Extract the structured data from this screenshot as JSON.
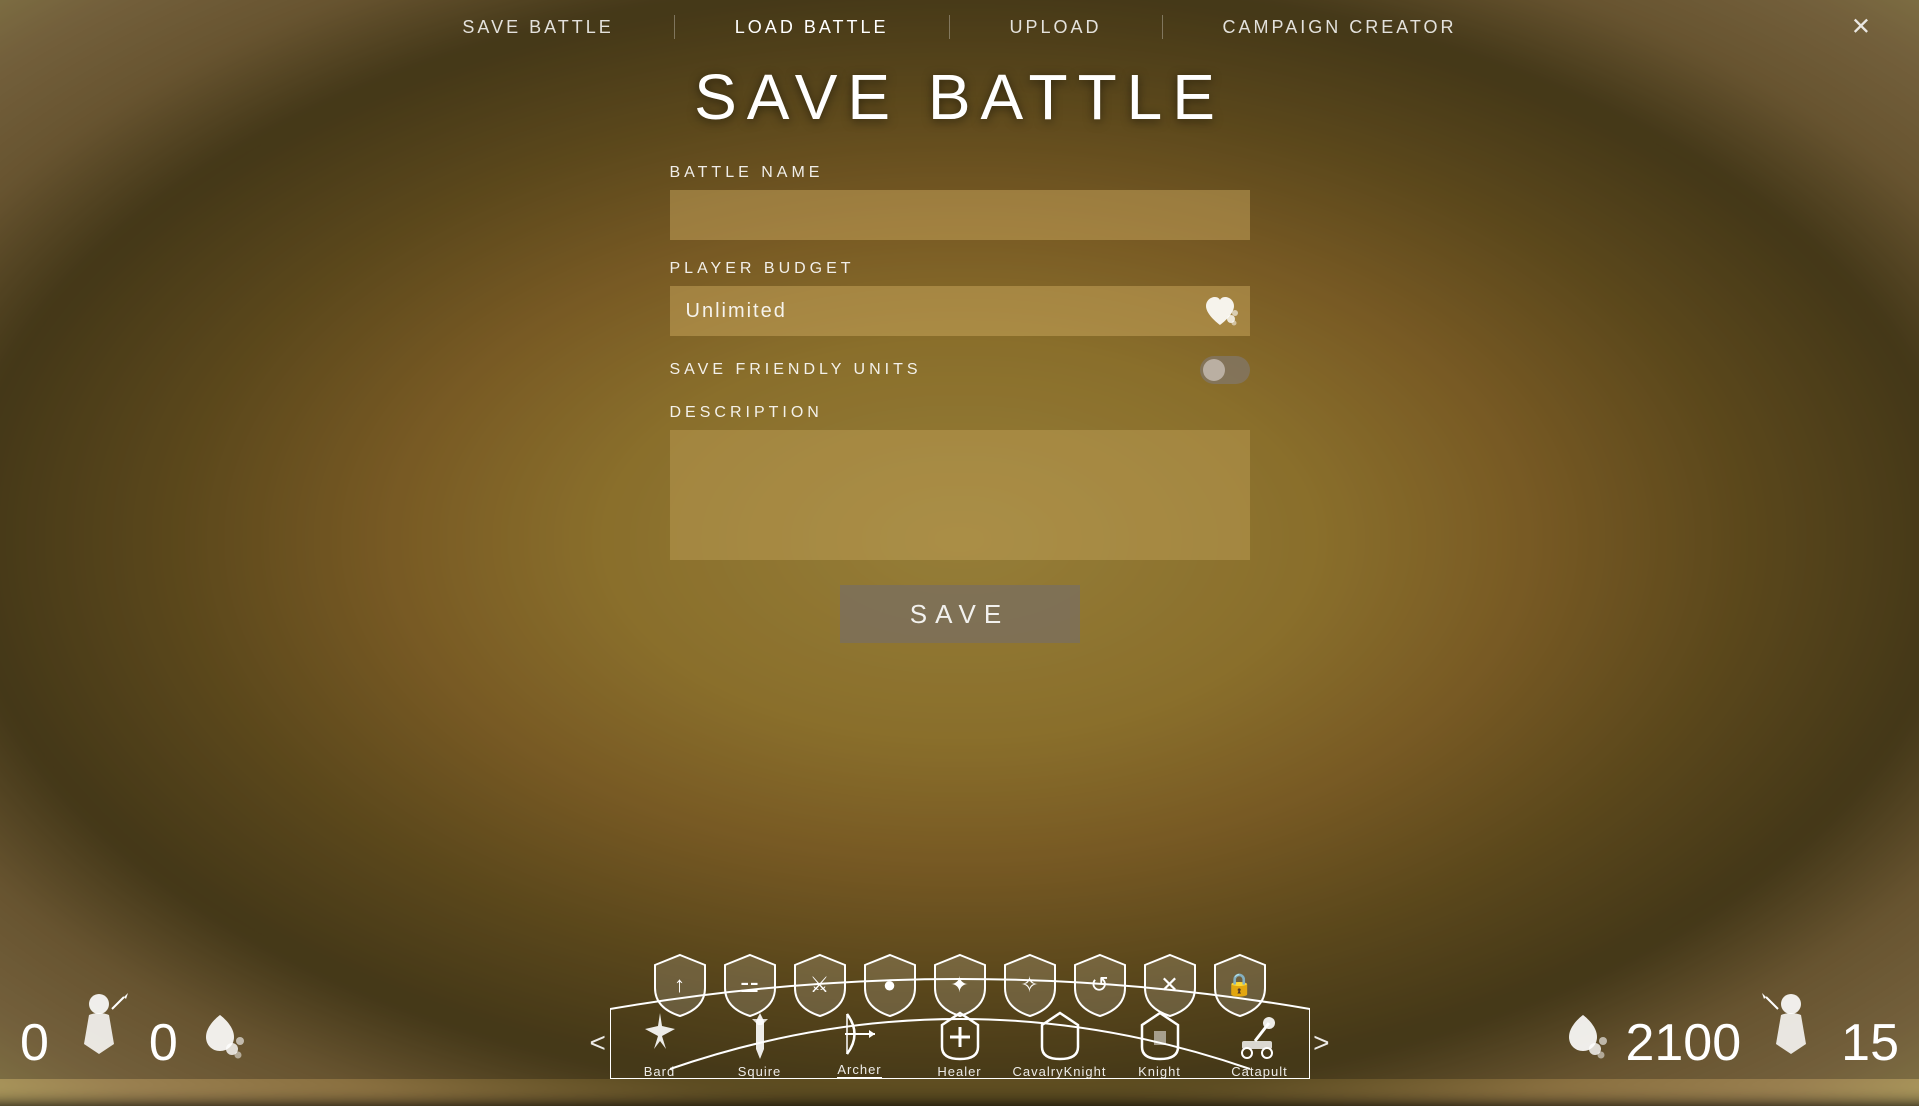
{
  "nav": {
    "save_battle": "Save Battle",
    "load_battle": "Load Battle",
    "upload": "Upload",
    "campaign_creator": "Campaign Creator",
    "close": "✕"
  },
  "dialog": {
    "title": "SAVE BATTLE",
    "battle_name_label": "BATTLE NAME",
    "battle_name_placeholder": "",
    "player_budget_label": "PLAYER BUDGET",
    "player_budget_value": "Unlimited",
    "save_friendly_label": "SAVE FRIENDLY UNITS",
    "description_label": "DESCRIPTION",
    "description_placeholder": "",
    "save_button": "SAVE"
  },
  "bottom_bar": {
    "left_count": "0",
    "left_budget_count": "0",
    "right_count": "15",
    "right_budget": "2100",
    "nav_left": "<",
    "nav_right": ">",
    "units": [
      {
        "name": "Bard",
        "icon": "♪",
        "active": false
      },
      {
        "name": "Squire",
        "icon": "⚔",
        "active": false
      },
      {
        "name": "Archer",
        "icon": "🏹",
        "active": true
      },
      {
        "name": "Healer",
        "icon": "🛡",
        "active": false
      },
      {
        "name": "CavalryKnight",
        "icon": "🛡",
        "active": false
      },
      {
        "name": "Knight",
        "icon": "🛡",
        "active": false
      },
      {
        "name": "Catapult",
        "icon": "⚙",
        "active": false
      }
    ],
    "shield_icons": [
      "↑",
      "⚔",
      "⚔",
      "●",
      "✦",
      "✦",
      "↺",
      "✕",
      "🔒"
    ]
  }
}
